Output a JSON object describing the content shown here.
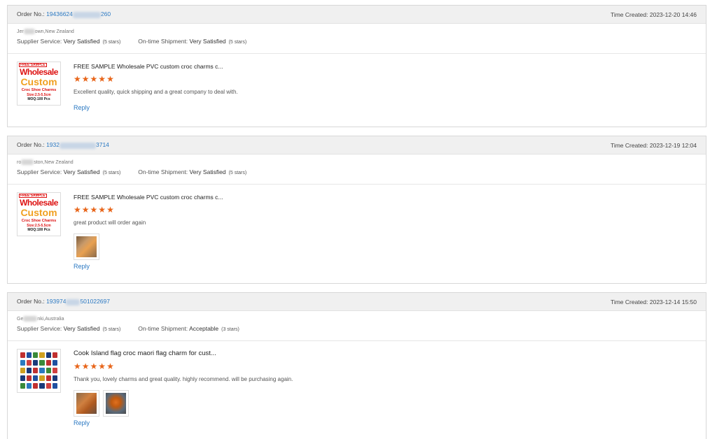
{
  "reviews": [
    {
      "order_label": "Order No.:",
      "order_prefix": "19436624",
      "order_suffix": "260",
      "time_label": "Time Created:",
      "time": "2023-12-20 14:46",
      "location_prefix": "Jer",
      "location_suffix": "own,New Zealand",
      "supplier_label": "Supplier Service:",
      "supplier_value": "Very Satisfied",
      "supplier_stars": "(5 stars)",
      "shipment_label": "On-time Shipment:",
      "shipment_value": "Very Satisfied",
      "shipment_stars": "(5 stars)",
      "product_title": "FREE SAMPLE Wholesale PVC custom croc charms c...",
      "rating": 5,
      "comment": "Excellent quality, quick shipping and a great company to deal with.",
      "photos": [],
      "reply_label": "Reply"
    },
    {
      "order_label": "Order No.:",
      "order_prefix": "1932",
      "order_suffix": "3714",
      "time_label": "Time Created:",
      "time": "2023-12-19 12:04",
      "location_prefix": "ro",
      "location_suffix": "ston,New Zealand",
      "supplier_label": "Supplier Service:",
      "supplier_value": "Very Satisfied",
      "supplier_stars": "(5 stars)",
      "shipment_label": "On-time Shipment:",
      "shipment_value": "Very Satisfied",
      "shipment_stars": "(5 stars)",
      "product_title": "FREE SAMPLE Wholesale PVC custom croc charms c...",
      "rating": 5,
      "comment": "great product will order again",
      "photos": [
        "review-photo-1"
      ],
      "reply_label": "Reply"
    },
    {
      "order_label": "Order No.:",
      "order_prefix": "193974",
      "order_suffix": "501022697",
      "time_label": "Time Created:",
      "time": "2023-12-14 15:50",
      "location_prefix": "Ge",
      "location_suffix": "nki,Australia",
      "supplier_label": "Supplier Service:",
      "supplier_value": "Very Satisfied",
      "supplier_stars": "(5 stars)",
      "shipment_label": "On-time Shipment:",
      "shipment_value": "Acceptable",
      "shipment_stars": "(3 stars)",
      "product_title": "Cook Island flag croc maori flag charm for cust...",
      "rating": 5,
      "comment": "Thank you, lovely charms and great quality. highly recommend. will be purchasing again.",
      "photos": [
        "review-photo-1",
        "review-photo-2"
      ],
      "reply_label": "Reply"
    }
  ],
  "product_image_text": {
    "free": "FREE SAMPLE",
    "line1": "Wholesale",
    "line2": "Custom",
    "line3": "Croc Shoe Charms",
    "line4": "Size:2.5-5.5cm",
    "line5": "MOQ:100 Pcs"
  },
  "colors": {
    "link": "#2a78c2",
    "star": "#e8651a",
    "header_bg": "#f0f0f0"
  }
}
